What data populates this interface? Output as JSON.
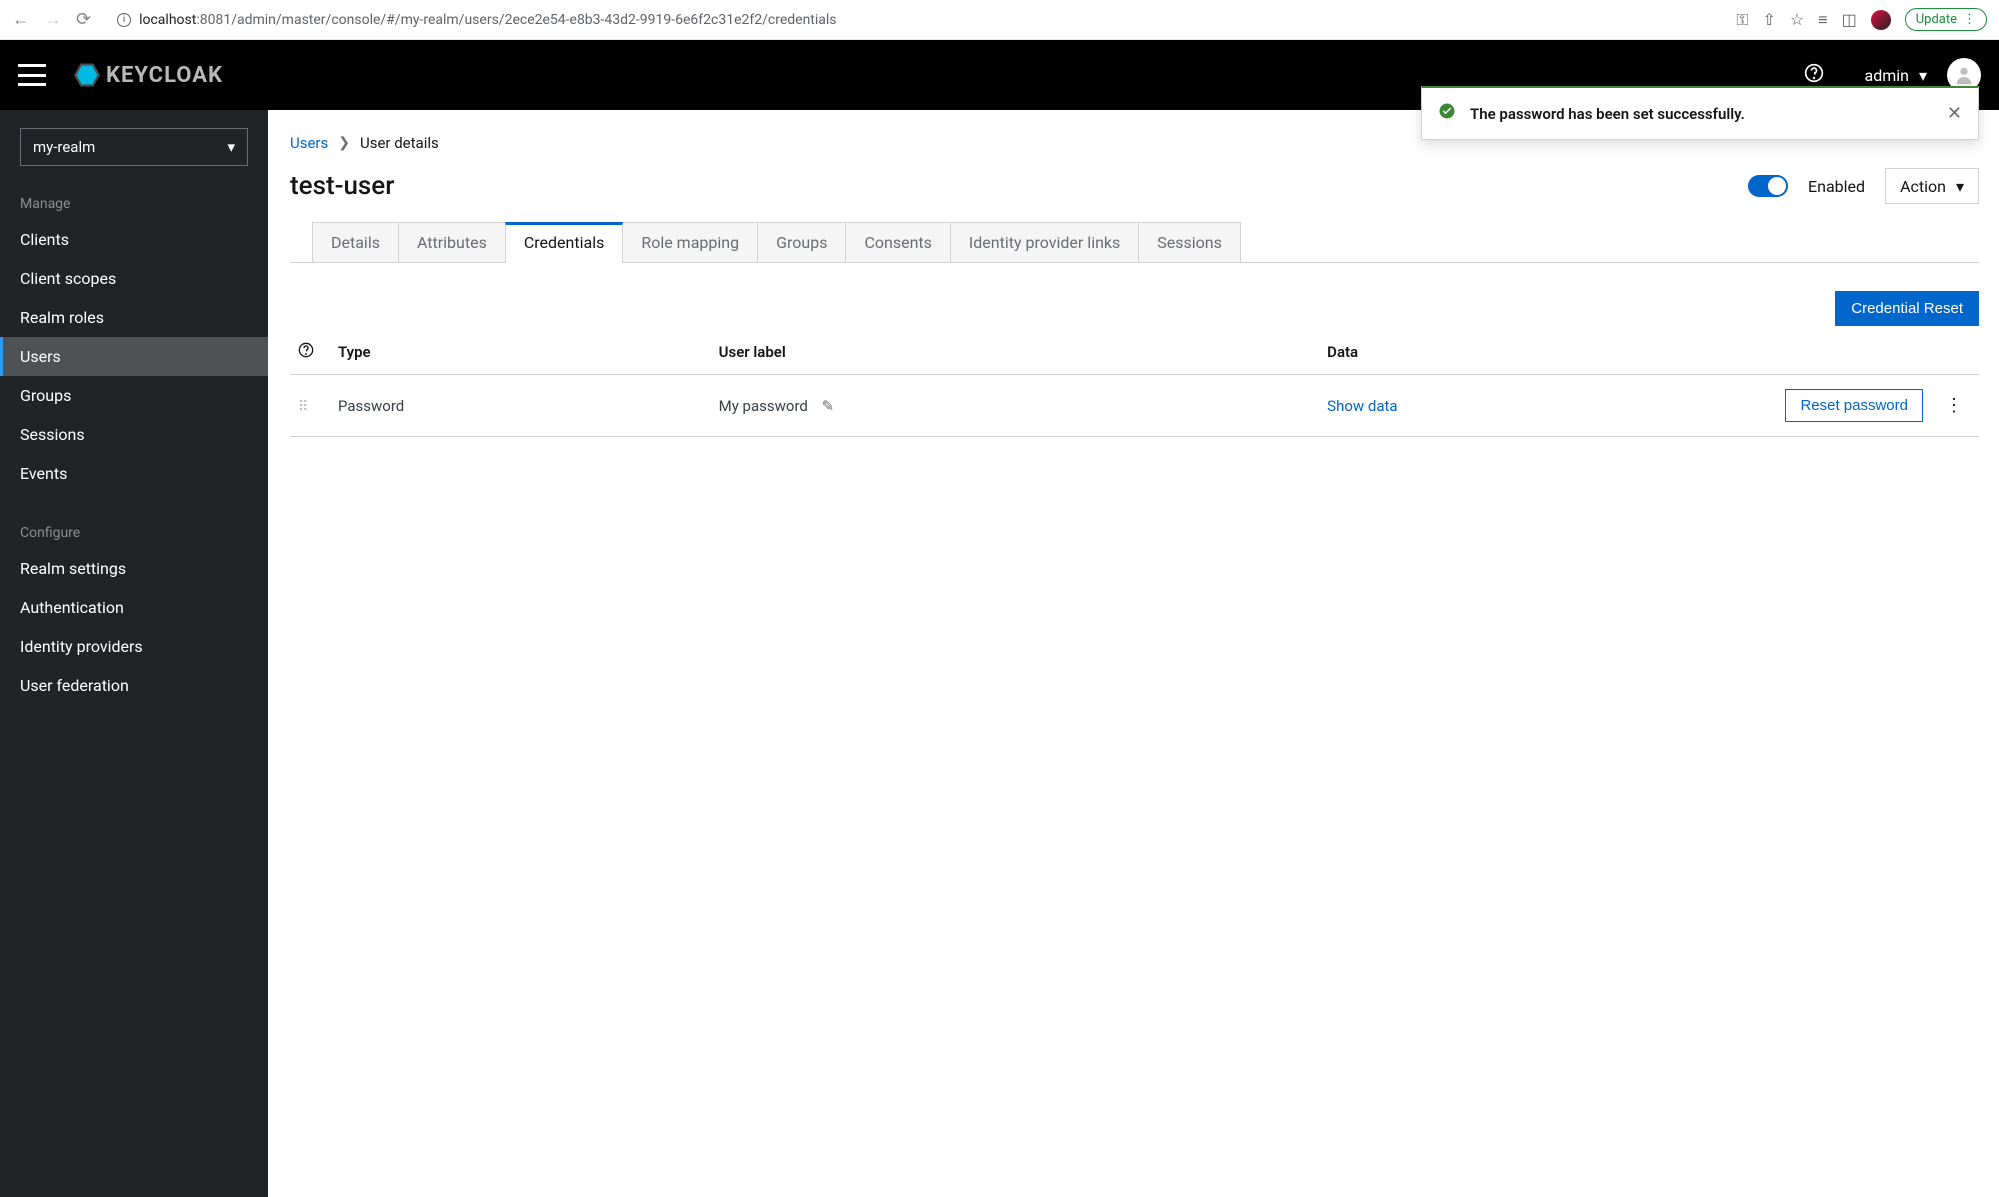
{
  "browser": {
    "url_host": "localhost",
    "url_path": ":8081/admin/master/console/#/my-realm/users/2ece2e54-e8b3-43d2-9919-6e6f2c31e2f2/credentials",
    "update_label": "Update"
  },
  "masthead": {
    "brand": "KEYCLOAK",
    "user": "admin"
  },
  "toast": {
    "message": "The password has been set successfully."
  },
  "sidebar": {
    "realm": "my-realm",
    "sections": {
      "manage": "Manage",
      "configure": "Configure"
    },
    "manage_items": [
      "Clients",
      "Client scopes",
      "Realm roles",
      "Users",
      "Groups",
      "Sessions",
      "Events"
    ],
    "configure_items": [
      "Realm settings",
      "Authentication",
      "Identity providers",
      "User federation"
    ],
    "active": "Users"
  },
  "breadcrumb": {
    "root": "Users",
    "current": "User details"
  },
  "page": {
    "title": "test-user",
    "enabled_label": "Enabled",
    "action_label": "Action"
  },
  "tabs": [
    "Details",
    "Attributes",
    "Credentials",
    "Role mapping",
    "Groups",
    "Consents",
    "Identity provider links",
    "Sessions"
  ],
  "active_tab": "Credentials",
  "buttons": {
    "credential_reset": "Credential Reset",
    "reset_password": "Reset password"
  },
  "table": {
    "headers": {
      "type": "Type",
      "user_label": "User label",
      "data": "Data"
    },
    "rows": [
      {
        "type": "Password",
        "user_label": "My password",
        "data_link": "Show data"
      }
    ]
  }
}
